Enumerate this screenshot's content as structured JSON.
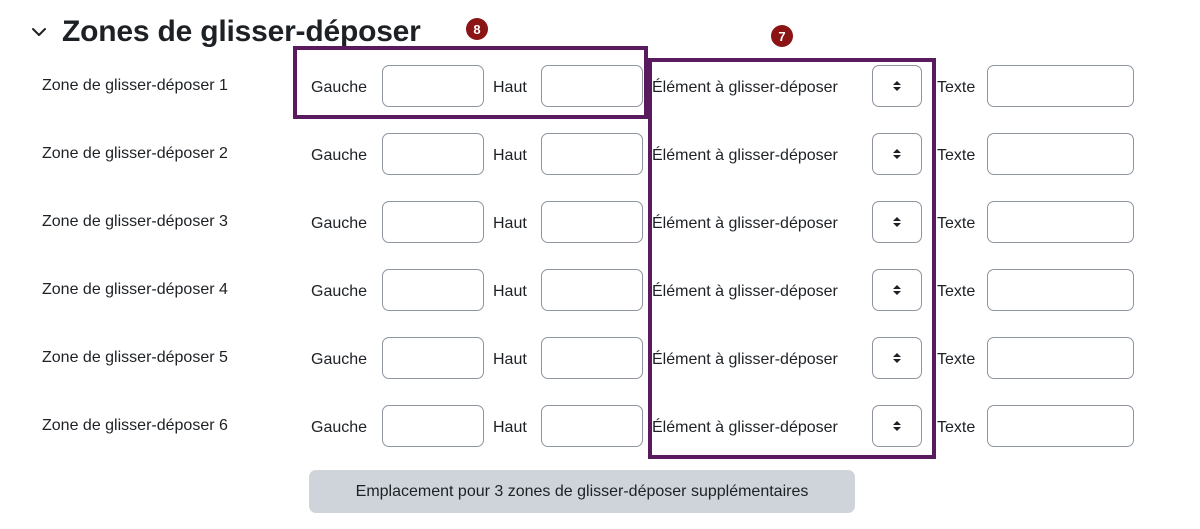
{
  "section": {
    "title": "Zones de glisser-déposer",
    "collapse_icon": "chevron-down-icon"
  },
  "annotations": {
    "badge_8": "8",
    "badge_7": "7",
    "badge_color": "#8b1414",
    "highlight_color": "#5a1a5e"
  },
  "field_labels": {
    "left": "Gauche",
    "top": "Haut",
    "drag_item": "Élément à glisser-déposer",
    "text": "Texte"
  },
  "dropzones": [
    {
      "label": "Zone de glisser-déposer 1",
      "left": "",
      "top": "",
      "drag_item": "",
      "text": ""
    },
    {
      "label": "Zone de glisser-déposer 2",
      "left": "",
      "top": "",
      "drag_item": "",
      "text": ""
    },
    {
      "label": "Zone de glisser-déposer 3",
      "left": "",
      "top": "",
      "drag_item": "",
      "text": ""
    },
    {
      "label": "Zone de glisser-déposer 4",
      "left": "",
      "top": "",
      "drag_item": "",
      "text": ""
    },
    {
      "label": "Zone de glisser-déposer 5",
      "left": "",
      "top": "",
      "drag_item": "",
      "text": ""
    },
    {
      "label": "Zone de glisser-déposer 6",
      "left": "",
      "top": "",
      "drag_item": "",
      "text": ""
    }
  ],
  "add_button": {
    "label": "Emplacement pour 3 zones de glisser-déposer supplémentaires"
  }
}
